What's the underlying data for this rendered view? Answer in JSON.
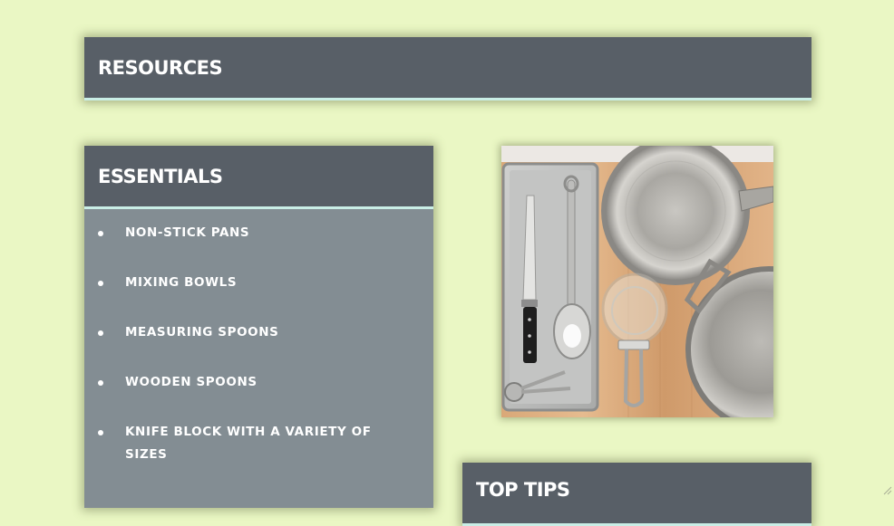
{
  "resources": {
    "title": "RESOURCES"
  },
  "essentials": {
    "title": "ESSENTIALS",
    "items": [
      {
        "label": "NON-STICK PANS"
      },
      {
        "label": "MIXING BOWLS"
      },
      {
        "label": "MEASURING SPOONS"
      },
      {
        "label": "WOODEN SPOONS"
      },
      {
        "label": "KNIFE BLOCK WITH A VARIETY OF SIZES"
      }
    ]
  },
  "top_tips": {
    "title": "TOP TIPS"
  },
  "colors": {
    "page_background": "#eaf7c4",
    "header_background": "#585f67",
    "list_background": "#838d93",
    "header_underline": "#c9eee6",
    "text": "#ffffff"
  },
  "photo": {
    "description_icon": "kitchen-tools-photo"
  }
}
